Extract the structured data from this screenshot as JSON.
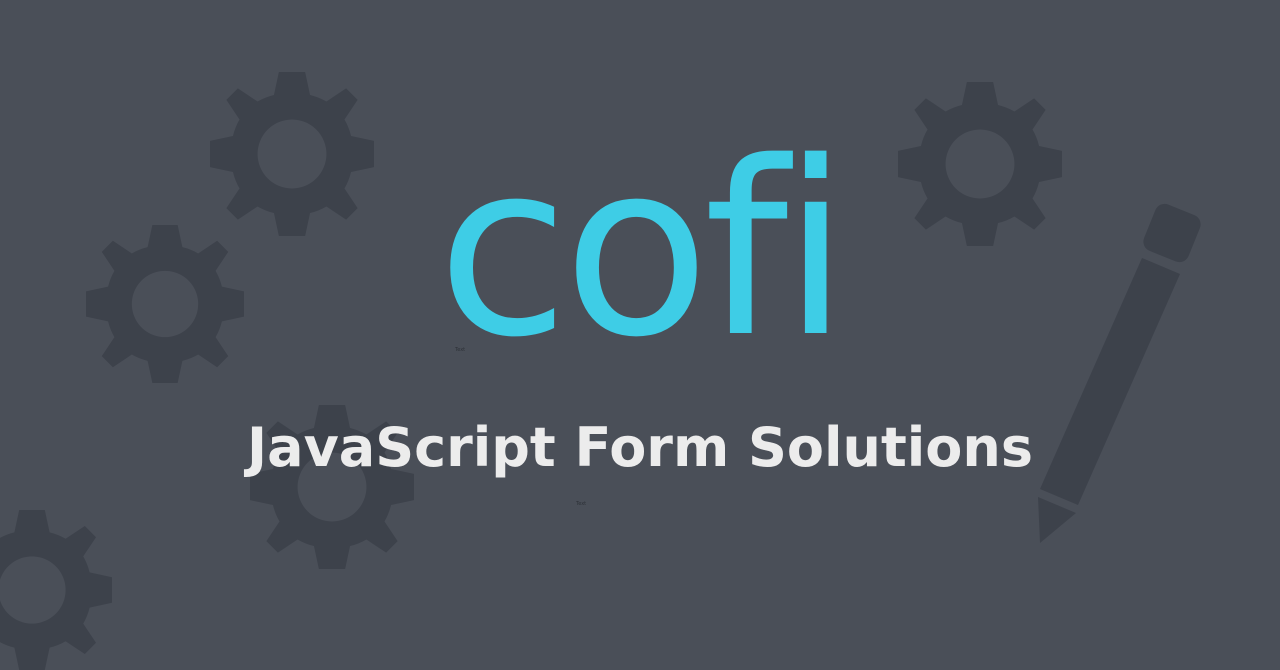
{
  "logo": {
    "text": "cofi"
  },
  "tagline": {
    "text": "JavaScript Form Solutions"
  },
  "tiny_labels": [
    "Text",
    "Text"
  ],
  "colors": {
    "background": "#4a4f58",
    "decoration": "#3d424b",
    "logo": "#3ecde6",
    "tagline": "#ececec"
  },
  "decorations": {
    "gear_icon": "gear-icon",
    "pencil_icon": "pencil-icon"
  }
}
